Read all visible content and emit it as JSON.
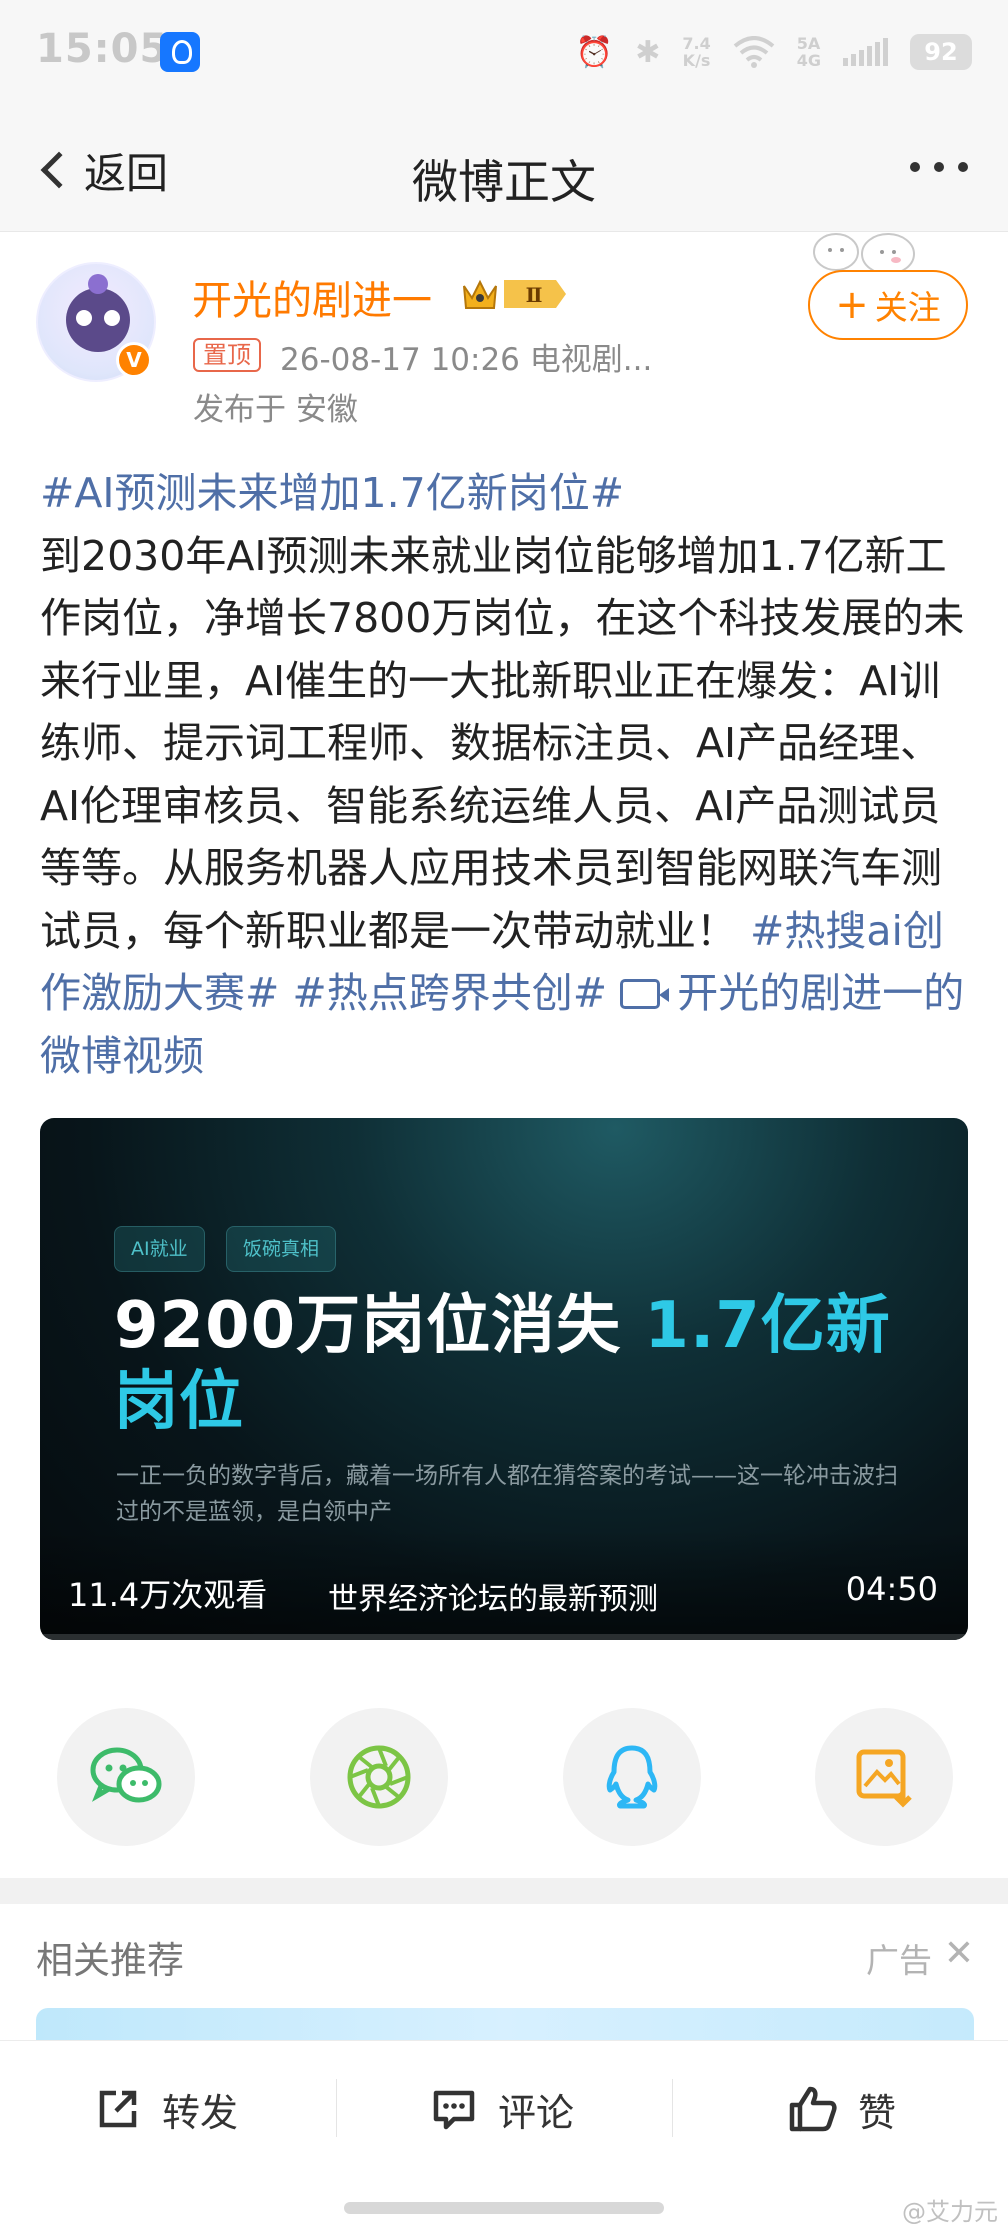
{
  "status_bar": {
    "time": "15:05",
    "net_speed_value": "7.4",
    "net_speed_unit": "K/s",
    "network_top": "5A",
    "network_bottom": "4G",
    "battery": "92"
  },
  "nav": {
    "back_label": "返回",
    "title": "微博正文"
  },
  "post": {
    "username": "开光的剧进一",
    "vip_level": "Ⅱ",
    "pin_label": "置顶",
    "meta": "26-08-17 10:26  电视剧...",
    "location": "发布于 安徽",
    "follow_label": "关注",
    "topic_1": "#AI预测未来增加1.7亿新岗位#",
    "body_text": "到2030年AI预测未来就业岗位能够增加1.7亿新工作岗位，净增长7800万岗位，在这个科技发展的未来行业里，AI催生的一大批新职业正在爆发：AI训练师、提示词工程师、数据标注员、AI产品经理、AI伦理审核员、智能系统运维人员、AI产品测试员等等。从服务机器人应用技术员到智能网联汽车测试员，每个新职业都是一次带动就业！",
    "topic_2": "#热搜ai创作激励大赛#",
    "topic_3": "#热点跨界共创#",
    "video_link": "开光的剧进一的微博视频"
  },
  "video": {
    "tag_1": "AI就业",
    "tag_2": "饭碗真相",
    "headline_white": "9200万岗位消失 ",
    "headline_cyan": "1.7亿新岗位",
    "subtext": "一正一负的数字背后，藏着一场所有人都在猜答案的考试——这一轮冲击波扫过的不是蓝领，是白领中产",
    "views": "11.4万次观看",
    "caption": "世界经济论坛的最新预测",
    "duration": "04:50"
  },
  "share": {
    "icons": [
      "wechat-icon",
      "moments-icon",
      "qq-icon",
      "save-image-icon"
    ]
  },
  "related": {
    "title": "相关推荐",
    "ad_label": "广告"
  },
  "actions": {
    "repost": "转发",
    "comment": "评论",
    "like": "赞"
  },
  "watermark": "@艾力元",
  "colors": {
    "accent_orange": "#ff8200",
    "topic_blue": "#4f6fa7",
    "video_cyan": "#2ec9e6"
  }
}
